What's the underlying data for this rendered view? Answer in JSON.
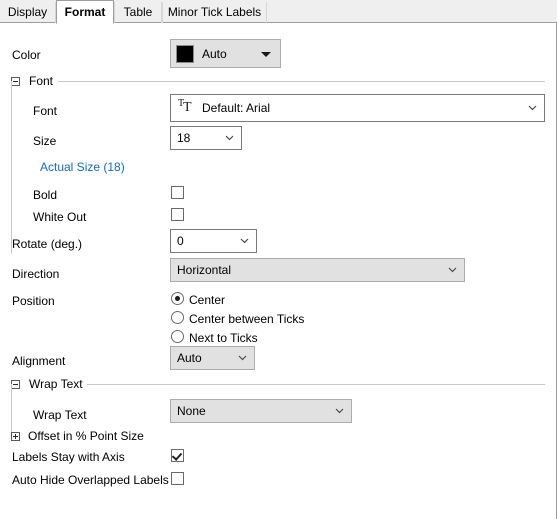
{
  "tabs": [
    {
      "label": "Display",
      "active": false
    },
    {
      "label": "Format",
      "active": true
    },
    {
      "label": "Table",
      "active": false
    },
    {
      "label": "Minor Tick Labels",
      "active": false
    }
  ],
  "form": {
    "color": {
      "label": "Color",
      "value": "Auto",
      "swatch_color": "#000000",
      "caret_icon": "caret-down-icon"
    },
    "font_group": {
      "title": "Font",
      "expander_state": "expanded",
      "font": {
        "label": "Font",
        "value": "Default: Arial",
        "icon": "font-tt-icon",
        "chevron_icon": "chevron-down-icon"
      },
      "size": {
        "label": "Size",
        "value": "18",
        "chevron_icon": "chevron-down-icon"
      },
      "actual_size_link": "Actual Size (18)",
      "bold": {
        "label": "Bold",
        "checked": false
      },
      "white_out": {
        "label": "White Out",
        "checked": false
      }
    },
    "rotate": {
      "label": "Rotate (deg.)",
      "value": "0",
      "chevron_icon": "chevron-down-icon"
    },
    "direction": {
      "label": "Direction",
      "value": "Horizontal",
      "chevron_icon": "chevron-down-icon"
    },
    "position": {
      "label": "Position",
      "options": [
        {
          "label": "Center",
          "selected": true
        },
        {
          "label": "Center between Ticks",
          "selected": false
        },
        {
          "label": "Next to Ticks",
          "selected": false
        }
      ]
    },
    "alignment": {
      "label": "Alignment",
      "value": "Auto",
      "chevron_icon": "chevron-down-icon"
    },
    "wrap_text_group": {
      "title": "Wrap Text",
      "expander_state": "expanded",
      "wrap_text": {
        "label": "Wrap Text",
        "value": "None",
        "chevron_icon": "chevron-down-icon"
      }
    },
    "offset_group": {
      "title": "Offset in % Point Size",
      "expander_state": "collapsed"
    },
    "labels_stay_with_axis": {
      "label": "Labels Stay with Axis",
      "checked": true
    },
    "auto_hide_overlapped_labels": {
      "label": "Auto Hide Overlapped Labels",
      "checked": false
    }
  }
}
